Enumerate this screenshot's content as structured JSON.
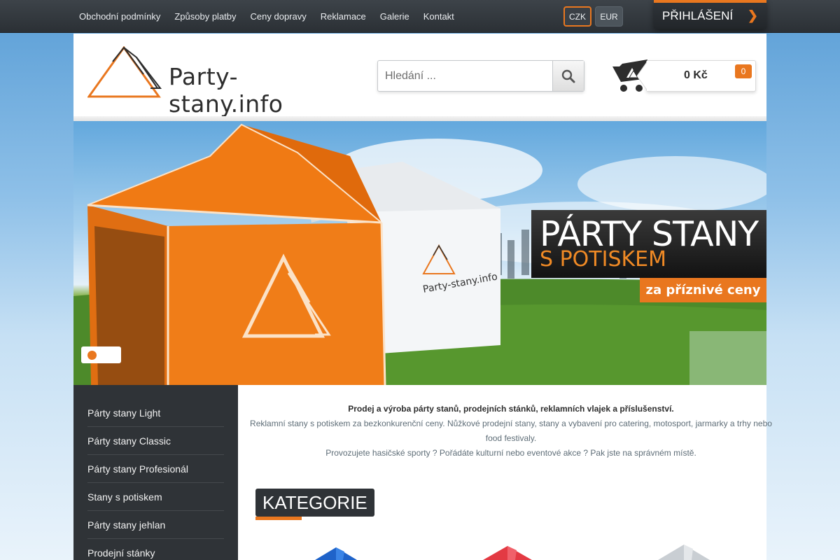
{
  "topnav": {
    "items": [
      "Obchodní podmínky",
      "Způsoby platby",
      "Ceny dopravy",
      "Reklamace",
      "Galerie",
      "Kontakt"
    ]
  },
  "currency": {
    "options": [
      "CZK",
      "EUR"
    ],
    "selected": "CZK"
  },
  "login": {
    "label": "PŘIHLÁŠENÍ"
  },
  "logo": {
    "text": "Party-stany.info"
  },
  "search": {
    "placeholder": "Hledání ..."
  },
  "cart": {
    "price": "0 Kč",
    "count": "0"
  },
  "hero": {
    "title": "PÁRTY STANY",
    "subtitle": "S POTISKEM",
    "tag": "za příznivé ceny",
    "tent_logo_text": "Party-stany.info"
  },
  "sidebar": {
    "items": [
      "Párty stany Light",
      "Párty stany Classic",
      "Párty stany Profesionál",
      "Stany s potiskem",
      "Párty stany jehlan",
      "Prodejní stánky"
    ]
  },
  "intro": {
    "lead": "Prodej a výroba párty stanů, prodejních stánků, reklamních vlajek a příslušenství.",
    "line1": "Reklamní stany s potiskem za bezkonkurenční ceny. Nůžkové prodejní stany, stany a vybavení pro catering, motosport, jarmarky a trhy nebo food festivaly.",
    "line2": "Provozujete hasičské sporty ? Pořádáte kulturní nebo eventové akce ? Pak jste na správném místě."
  },
  "section": {
    "title": "KATEGORIE"
  },
  "colors": {
    "accent": "#e9771f",
    "dark": "#2f3337"
  }
}
